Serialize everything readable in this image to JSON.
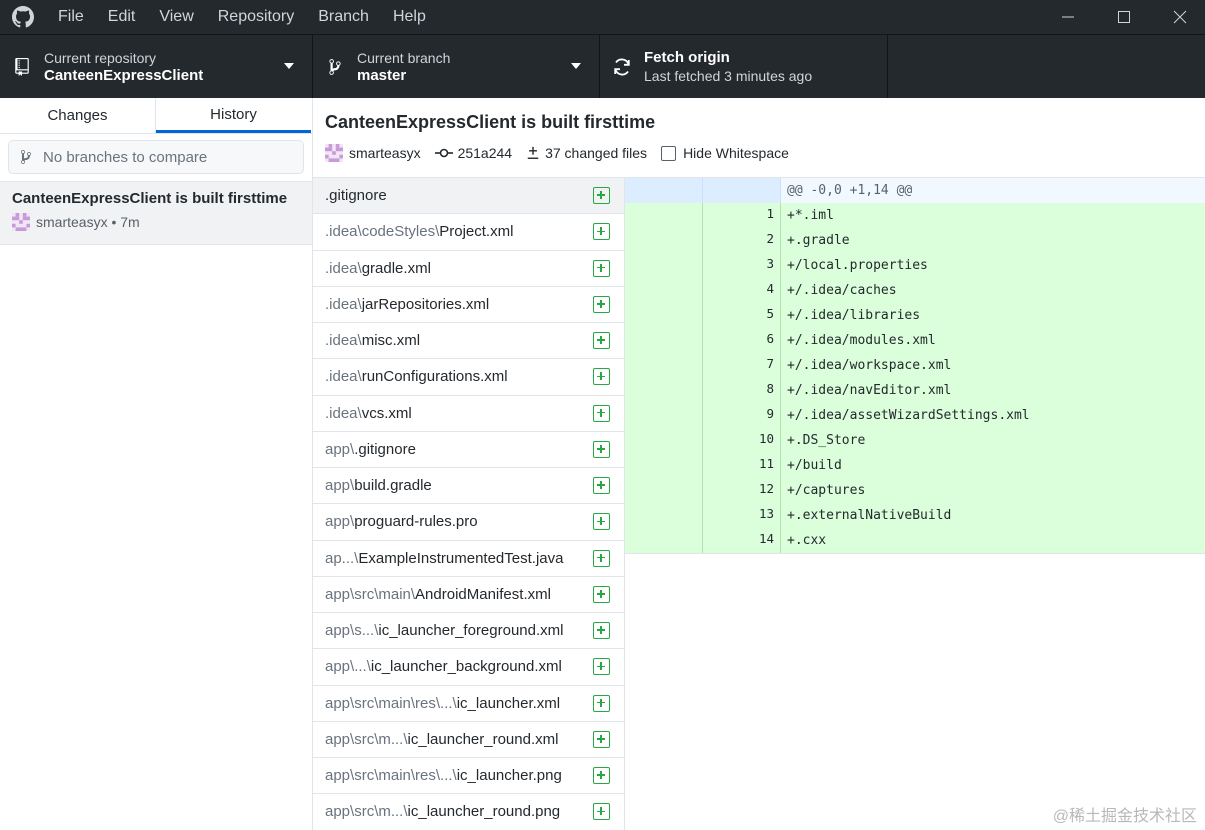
{
  "menu": {
    "items": [
      "File",
      "Edit",
      "View",
      "Repository",
      "Branch",
      "Help"
    ]
  },
  "toolbar": {
    "repo_label": "Current repository",
    "repo_name": "CanteenExpressClient",
    "branch_label": "Current branch",
    "branch_name": "master",
    "fetch_title": "Fetch origin",
    "fetch_subtitle": "Last fetched 3 minutes ago"
  },
  "sidebar": {
    "tabs": [
      "Changes",
      "History"
    ],
    "active_tab": "History",
    "compare_placeholder": "No branches to compare",
    "commit": {
      "title": "CanteenExpressClient is built firsttime",
      "author": "smarteasyx",
      "time": "smarteasyx • 7m"
    }
  },
  "commit": {
    "title": "CanteenExpressClient is built firsttime",
    "author": "smarteasyx",
    "sha": "251a244",
    "changed_files": "37 changed files",
    "hide_whitespace": "Hide Whitespace"
  },
  "files": [
    {
      "path": "",
      "name": ".gitignore",
      "status": "added"
    },
    {
      "path": ".idea\\codeStyles\\",
      "name": "Project.xml",
      "status": "added"
    },
    {
      "path": ".idea\\",
      "name": "gradle.xml",
      "status": "added"
    },
    {
      "path": ".idea\\",
      "name": "jarRepositories.xml",
      "status": "added"
    },
    {
      "path": ".idea\\",
      "name": "misc.xml",
      "status": "added"
    },
    {
      "path": ".idea\\",
      "name": "runConfigurations.xml",
      "status": "added"
    },
    {
      "path": ".idea\\",
      "name": "vcs.xml",
      "status": "added"
    },
    {
      "path": "app\\",
      "name": ".gitignore",
      "status": "added"
    },
    {
      "path": "app\\",
      "name": "build.gradle",
      "status": "added"
    },
    {
      "path": "app\\",
      "name": "proguard-rules.pro",
      "status": "added"
    },
    {
      "path": "ap...\\",
      "name": "ExampleInstrumentedTest.java",
      "status": "added"
    },
    {
      "path": "app\\src\\main\\",
      "name": "AndroidManifest.xml",
      "status": "added"
    },
    {
      "path": "app\\s...\\",
      "name": "ic_launcher_foreground.xml",
      "status": "added"
    },
    {
      "path": "app\\...\\",
      "name": "ic_launcher_background.xml",
      "status": "added"
    },
    {
      "path": "app\\src\\main\\res\\...\\",
      "name": "ic_launcher.xml",
      "status": "added"
    },
    {
      "path": "app\\src\\m...\\",
      "name": "ic_launcher_round.xml",
      "status": "added"
    },
    {
      "path": "app\\src\\main\\res\\...\\",
      "name": "ic_launcher.png",
      "status": "added"
    },
    {
      "path": "app\\src\\m...\\",
      "name": "ic_launcher_round.png",
      "status": "added"
    }
  ],
  "diff": {
    "hunk": "@@ -0,0 +1,14 @@",
    "lines": [
      {
        "num": "1",
        "text": "+*.iml"
      },
      {
        "num": "2",
        "text": "+.gradle"
      },
      {
        "num": "3",
        "text": "+/local.properties"
      },
      {
        "num": "4",
        "text": "+/.idea/caches"
      },
      {
        "num": "5",
        "text": "+/.idea/libraries"
      },
      {
        "num": "6",
        "text": "+/.idea/modules.xml"
      },
      {
        "num": "7",
        "text": "+/.idea/workspace.xml"
      },
      {
        "num": "8",
        "text": "+/.idea/navEditor.xml"
      },
      {
        "num": "9",
        "text": "+/.idea/assetWizardSettings.xml"
      },
      {
        "num": "10",
        "text": "+.DS_Store"
      },
      {
        "num": "11",
        "text": "+/build"
      },
      {
        "num": "12",
        "text": "+/captures"
      },
      {
        "num": "13",
        "text": "+.externalNativeBuild"
      },
      {
        "num": "14",
        "text": "+.cxx"
      }
    ]
  },
  "watermark": "@稀土掘金技术社区",
  "colors": {
    "toolbar_bg": "#24292e",
    "accent": "#0366d6",
    "added": "#28a745",
    "diff_added_bg": "#dbffdb"
  }
}
